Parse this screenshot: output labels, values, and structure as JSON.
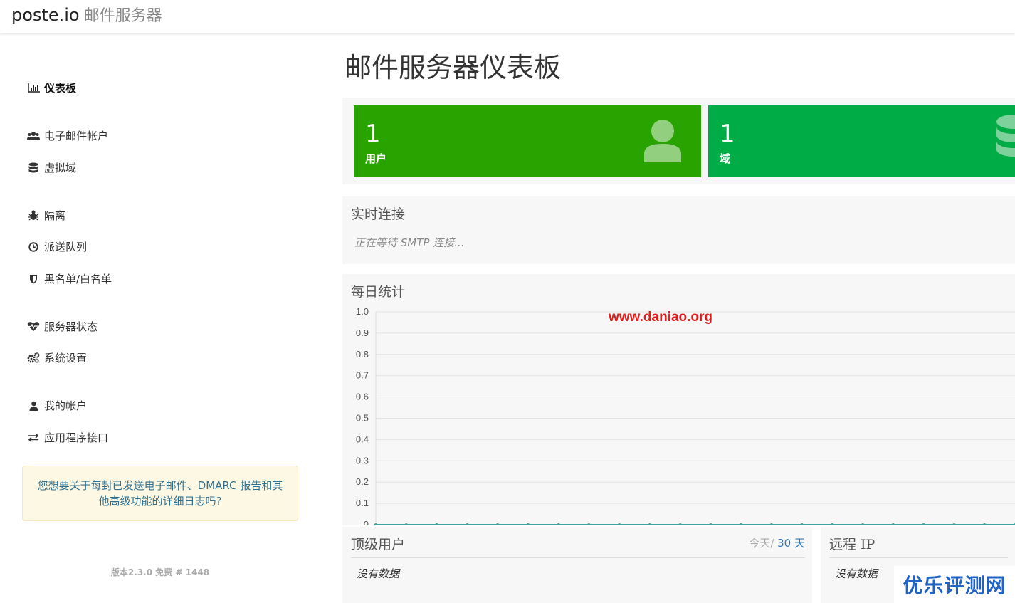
{
  "app": {
    "brand": "poste.io",
    "subtitle": "邮件服务器"
  },
  "sidebar": {
    "items": [
      {
        "label": "仪表板",
        "icon": "bar-chart-icon"
      },
      {
        "label": "电子邮件帐户",
        "icon": "users-icon"
      },
      {
        "label": "虚拟域",
        "icon": "database-icon"
      },
      {
        "label": "隔离",
        "icon": "bug-icon"
      },
      {
        "label": "派送队列",
        "icon": "clock-icon"
      },
      {
        "label": "黑名单/白名单",
        "icon": "shield-icon"
      },
      {
        "label": "服务器状态",
        "icon": "heartbeat-icon"
      },
      {
        "label": "系统设置",
        "icon": "cogs-icon"
      },
      {
        "label": "我的帐户",
        "icon": "user-icon"
      },
      {
        "label": "应用程序接口",
        "icon": "exchange-icon"
      }
    ],
    "promo": "您想要关于每封已发送电子邮件、DMARC 报告和其他高级功能的详细日志吗?",
    "version": "版本2.3.0 免费 # 1448"
  },
  "main": {
    "title": "邮件服务器仪表板",
    "tiles": [
      {
        "value": "1",
        "label": "用户",
        "icon": "user-icon",
        "color": "#29a300"
      },
      {
        "value": "1",
        "label": "域",
        "icon": "database-icon",
        "color": "#00ac46"
      }
    ],
    "live": {
      "title": "实时连接",
      "status": "正在等待 SMTP 连接..."
    },
    "daily": {
      "title": "每日统计"
    },
    "top_users": {
      "title": "顶级用户",
      "range_today": "今天",
      "range_sep": "/ ",
      "range_30": "30 天",
      "empty": "没有数据"
    },
    "remote_ip": {
      "title": "远程 IP",
      "empty": "没有数据"
    }
  },
  "watermarks": {
    "site": "www.daniao.org",
    "logo": "优乐评测网"
  },
  "chart_data": {
    "type": "line",
    "ylim": [
      0,
      1
    ],
    "yticks": [
      "1.0",
      "0.9",
      "0.8",
      "0.7",
      "0.6",
      "0.5",
      "0.4",
      "0.3",
      "0.2",
      "0.1",
      "0"
    ],
    "series": [
      {
        "values": [
          0,
          0,
          0,
          0,
          0,
          0,
          0,
          0,
          0,
          0,
          0,
          0,
          0,
          0,
          0,
          0,
          0,
          0,
          0,
          0,
          0,
          0
        ]
      }
    ],
    "grid": true,
    "line_color": "#3aa39a"
  }
}
